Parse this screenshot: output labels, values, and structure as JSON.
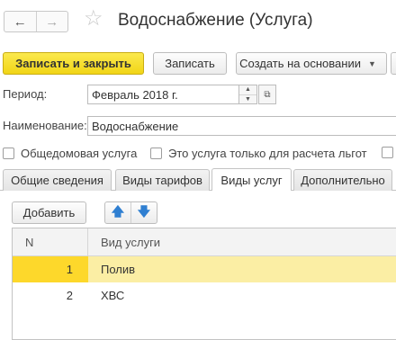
{
  "window": {
    "title": "Водоснабжение (Услуга)"
  },
  "nav": {
    "back_glyph": "←",
    "forward_glyph": "→",
    "star_glyph": "☆"
  },
  "toolbar": {
    "save_close_label": "Записать и закрыть",
    "save_label": "Записать",
    "create_based_label": "Создать на основании",
    "create_based_caret": "▼"
  },
  "form": {
    "period_label": "Период:",
    "period_value": "Февраль 2018 г.",
    "name_label": "Наименование:",
    "name_value": "Водоснабжение"
  },
  "checkboxes": {
    "common_house": "Общедомовая услуга",
    "benefit_calc_only": "Это услуга только для расчета льгот"
  },
  "tabs": [
    {
      "label": "Общие сведения"
    },
    {
      "label": "Виды тарифов"
    },
    {
      "label": "Виды услуг"
    },
    {
      "label": "Дополнительно"
    }
  ],
  "table_toolbar": {
    "add_label": "Добавить",
    "up_glyph": "🡅",
    "down_glyph": "🡇"
  },
  "table": {
    "columns": [
      "N",
      "Вид услуги"
    ],
    "rows": [
      {
        "n": "1",
        "service": "Полив"
      },
      {
        "n": "2",
        "service": "ХВС"
      }
    ],
    "selected_row": 0
  },
  "colors": {
    "primary_button": "#f4da22",
    "selected_row": "#fbeea4",
    "selected_cell": "#fdd82b",
    "arrow_blue": "#2f7fd1"
  }
}
